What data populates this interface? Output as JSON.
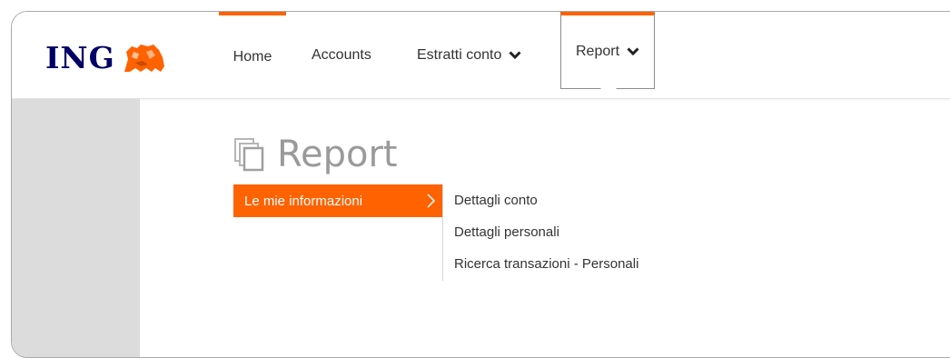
{
  "brand": {
    "logo_text": "ING",
    "accent": "#ff6200",
    "navy": "#000066"
  },
  "nav": {
    "home": "Home",
    "accounts": "Accounts",
    "estratti": "Estratti conto",
    "report": "Report"
  },
  "page": {
    "title": "Report"
  },
  "menu": {
    "primary_label": "Le mie informazioni",
    "sub_items": [
      "Dettagli conto",
      "Dettagli personali",
      "Ricerca transazioni - Personali"
    ]
  },
  "icons": {
    "logo": "lion-icon",
    "dropdown": "chevron-down-icon",
    "title": "copy-pages-icon",
    "submenu": "chevron-right-icon"
  }
}
